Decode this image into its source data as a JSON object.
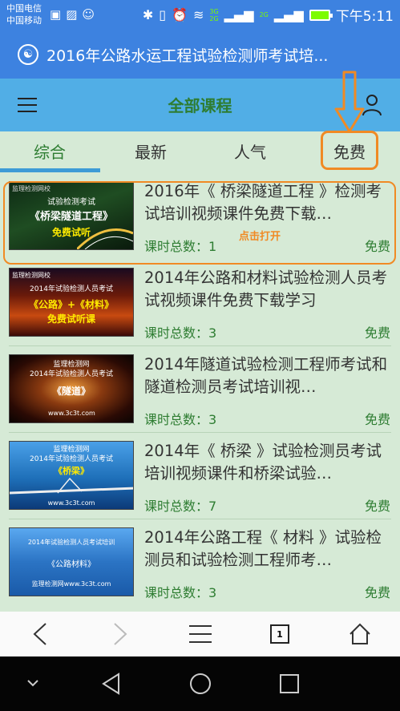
{
  "status_bar": {
    "carrier_1": "中国电信",
    "carrier_2": "中国移动",
    "net_3g": "3G",
    "net_2g_a": "2G",
    "net_2g_b": "2G",
    "time": "下午5:11"
  },
  "browser": {
    "page_title": "2016年公路水运工程试验检测师考试培..."
  },
  "header": {
    "title": "全部课程",
    "menu_icon": "hamburger-icon",
    "user_icon": "user-icon"
  },
  "tabs": [
    {
      "label": "综合",
      "active": true
    },
    {
      "label": "最新",
      "active": false
    },
    {
      "label": "人气",
      "active": false
    },
    {
      "label": "免费",
      "active": false
    }
  ],
  "annotation": {
    "click_open": "点击打开"
  },
  "courses": [
    {
      "title": "2016年《 桥梁隧道工程 》检测考试培训视频课件免费下载…",
      "count": "课时总数：1",
      "price": "免费",
      "thumb": {
        "top": "监理检测网校",
        "line1": "试验检测考试",
        "line2": "《桥梁隧道工程》",
        "line3": "免费试听",
        "bg": "#123a1a"
      }
    },
    {
      "title": "2014年公路和材料试验检测人员考试视频课件免费下载学习",
      "count": "课时总数：3",
      "price": "免费",
      "thumb": {
        "top": "监理检测网校",
        "line1": "2014年试验检测人员考试",
        "line2": "《公路》+《材料》",
        "line3": "免费试听课",
        "bg": "#4a1a0a"
      }
    },
    {
      "title": "2014年隧道试验检测工程师考试和隧道检测员考试培训视…",
      "count": "课时总数：3",
      "price": "免费",
      "thumb": {
        "top": "监理检测网",
        "line1": "2014年试验检测人员考试",
        "line2": "《隧道》",
        "line3": "www.3c3t.com",
        "bg": "#3a1a08"
      }
    },
    {
      "title": "2014年《 桥梁 》试验检测员考试培训视频课件和桥梁试验…",
      "count": "课时总数：7",
      "price": "免费",
      "thumb": {
        "top": "监理检测网",
        "line1": "2014年试验检测人员考试",
        "line2": "《桥梁》",
        "line3": "www.3c3t.com",
        "bg": "#1e6fb8"
      }
    },
    {
      "title": "2014年公路工程《 材料 》试验检测员和试验检测工程师考…",
      "count": "课时总数：3",
      "price": "免费",
      "thumb": {
        "top": "",
        "line1": "2014年试验检测人员考试培训",
        "line2": "《公路材料》",
        "line3": "监理检测网www.3c3t.com",
        "bg": "#2b74c4"
      }
    }
  ],
  "bottom_bar": {
    "tab_count": "1"
  }
}
